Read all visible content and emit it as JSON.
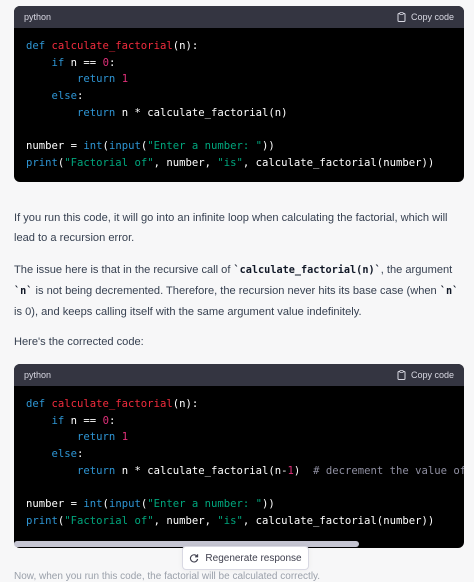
{
  "code_block_1": {
    "language": "python",
    "copy_label": "Copy code",
    "lines": [
      [
        {
          "t": "kw",
          "v": "def "
        },
        {
          "t": "fn",
          "v": "calculate_factorial"
        },
        {
          "t": "",
          "v": "(n):"
        }
      ],
      [
        {
          "t": "",
          "v": "    "
        },
        {
          "t": "kw",
          "v": "if"
        },
        {
          "t": "",
          "v": " n == "
        },
        {
          "t": "num",
          "v": "0"
        },
        {
          "t": "",
          "v": ":"
        }
      ],
      [
        {
          "t": "",
          "v": "        "
        },
        {
          "t": "kw",
          "v": "return"
        },
        {
          "t": "",
          "v": " "
        },
        {
          "t": "num",
          "v": "1"
        }
      ],
      [
        {
          "t": "",
          "v": "    "
        },
        {
          "t": "kw",
          "v": "else"
        },
        {
          "t": "",
          "v": ":"
        }
      ],
      [
        {
          "t": "",
          "v": "        "
        },
        {
          "t": "kw",
          "v": "return"
        },
        {
          "t": "",
          "v": " n * calculate_factorial(n)"
        }
      ],
      [
        {
          "t": "",
          "v": ""
        }
      ],
      [
        {
          "t": "",
          "v": "number = "
        },
        {
          "t": "kw",
          "v": "int"
        },
        {
          "t": "",
          "v": "("
        },
        {
          "t": "kw",
          "v": "input"
        },
        {
          "t": "",
          "v": "("
        },
        {
          "t": "str",
          "v": "\"Enter a number: \""
        },
        {
          "t": "",
          "v": "))"
        }
      ],
      [
        {
          "t": "kw",
          "v": "print"
        },
        {
          "t": "",
          "v": "("
        },
        {
          "t": "str",
          "v": "\"Factorial of\""
        },
        {
          "t": "",
          "v": ", number, "
        },
        {
          "t": "str",
          "v": "\"is\""
        },
        {
          "t": "",
          "v": ", calculate_factorial(number))"
        }
      ]
    ]
  },
  "paragraph_1": "If you run this code, it will go into an infinite loop when calculating the factorial, which will lead to a recursion error.",
  "paragraph_2": {
    "part1": "The issue here is that in the recursive call of ",
    "code1": "`calculate_factorial(n)`",
    "part2": ", the argument ",
    "code2": "`n`",
    "part3": " is not being decremented. Therefore, the recursion never hits its base case (when ",
    "code3": "`n`",
    "part4": " is 0), and keeps calling itself with the same argument value indefinitely."
  },
  "paragraph_3": "Here's the corrected code:",
  "code_block_2": {
    "language": "python",
    "copy_label": "Copy code",
    "lines": [
      [
        {
          "t": "kw",
          "v": "def "
        },
        {
          "t": "fn",
          "v": "calculate_factorial"
        },
        {
          "t": "",
          "v": "(n):"
        }
      ],
      [
        {
          "t": "",
          "v": "    "
        },
        {
          "t": "kw",
          "v": "if"
        },
        {
          "t": "",
          "v": " n == "
        },
        {
          "t": "num",
          "v": "0"
        },
        {
          "t": "",
          "v": ":"
        }
      ],
      [
        {
          "t": "",
          "v": "        "
        },
        {
          "t": "kw",
          "v": "return"
        },
        {
          "t": "",
          "v": " "
        },
        {
          "t": "num",
          "v": "1"
        }
      ],
      [
        {
          "t": "",
          "v": "    "
        },
        {
          "t": "kw",
          "v": "else"
        },
        {
          "t": "",
          "v": ":"
        }
      ],
      [
        {
          "t": "",
          "v": "        "
        },
        {
          "t": "kw",
          "v": "return"
        },
        {
          "t": "",
          "v": " n * calculate_factorial(n-"
        },
        {
          "t": "num",
          "v": "1"
        },
        {
          "t": "",
          "v": ")  "
        },
        {
          "t": "cm",
          "v": "# decrement the value of n"
        }
      ],
      [
        {
          "t": "",
          "v": ""
        }
      ],
      [
        {
          "t": "",
          "v": "number = "
        },
        {
          "t": "kw",
          "v": "int"
        },
        {
          "t": "",
          "v": "("
        },
        {
          "t": "kw",
          "v": "input"
        },
        {
          "t": "",
          "v": "("
        },
        {
          "t": "str",
          "v": "\"Enter a number: \""
        },
        {
          "t": "",
          "v": "))"
        }
      ],
      [
        {
          "t": "kw",
          "v": "print"
        },
        {
          "t": "",
          "v": "("
        },
        {
          "t": "str",
          "v": "\"Factorial of\""
        },
        {
          "t": "",
          "v": ", number, "
        },
        {
          "t": "str",
          "v": "\"is\""
        },
        {
          "t": "",
          "v": ", calculate_factorial(number))"
        }
      ]
    ]
  },
  "regenerate_label": "Regenerate response",
  "faded_text": "Now, when you run this code, the factorial will be calculated correctly.",
  "colors": {
    "keyword": "#2e95d3",
    "function": "#f22c3d",
    "number": "#df3079",
    "string": "#00a67d",
    "comment": "#8e8ea0",
    "code_bg": "#000000",
    "code_header_bg": "#343541"
  }
}
